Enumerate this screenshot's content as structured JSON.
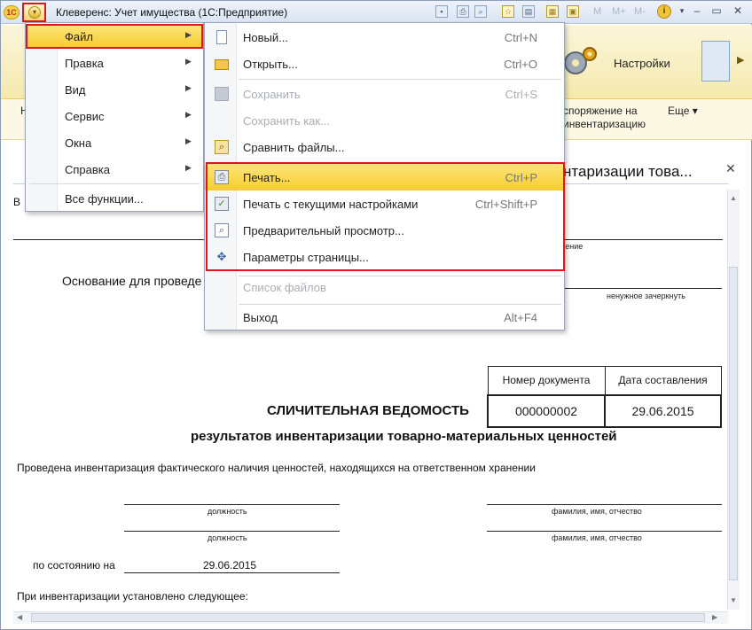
{
  "window": {
    "title": "Клеверенс: Учет имущества  (1С:Предприятие)",
    "logo": "1С",
    "toolbar_texts": [
      "M",
      "M+",
      "M-"
    ]
  },
  "ribbon": {
    "settings_label": "Настройки"
  },
  "nav": {
    "first_fragment": "Н",
    "link_1": "споряжение на инвентаризацию",
    "more": "Еще ▾"
  },
  "main_menu": {
    "items": [
      {
        "label": "Файл",
        "has_submenu": true,
        "active": true
      },
      {
        "label": "Правка",
        "has_submenu": true
      },
      {
        "label": "Вид",
        "has_submenu": true
      },
      {
        "label": "Сервис",
        "has_submenu": true
      },
      {
        "label": "Окна",
        "has_submenu": true
      },
      {
        "label": "Справка",
        "has_submenu": true
      },
      {
        "label": "Все функции...",
        "has_submenu": false
      }
    ]
  },
  "file_menu": {
    "items": [
      {
        "label": "Новый...",
        "shortcut": "Ctrl+N",
        "icon": "new-document-icon",
        "disabled": false
      },
      {
        "label": "Открыть...",
        "shortcut": "Ctrl+O",
        "icon": "open-folder-icon",
        "disabled": false
      },
      {
        "label": "Сохранить",
        "shortcut": "Ctrl+S",
        "icon": "save-icon",
        "disabled": true
      },
      {
        "label": "Сохранить как...",
        "shortcut": "",
        "icon": "",
        "disabled": true
      },
      {
        "label": "Сравнить файлы...",
        "shortcut": "",
        "icon": "compare-files-icon",
        "disabled": false
      },
      {
        "label": "Печать...",
        "shortcut": "Ctrl+P",
        "icon": "printer-icon",
        "disabled": false,
        "highlighted": true
      },
      {
        "label": "Печать с текущими настройками",
        "shortcut": "Ctrl+Shift+P",
        "icon": "quick-print-icon",
        "disabled": false
      },
      {
        "label": "Предварительный просмотр...",
        "shortcut": "",
        "icon": "print-preview-icon",
        "disabled": false
      },
      {
        "label": "Параметры страницы...",
        "shortcut": "",
        "icon": "page-setup-icon",
        "disabled": false
      },
      {
        "label": "Список файлов",
        "shortcut": "",
        "icon": "",
        "disabled": true
      },
      {
        "label": "Выход",
        "shortcut": "Alt+F4",
        "icon": "",
        "disabled": false
      }
    ]
  },
  "document": {
    "header_fragment": "нтаризации това...",
    "left_fragment_B": "В",
    "small_fragment_1": "ление",
    "basis_label": "Основание для проведе",
    "strike_hint": "ненужное зачеркнуть",
    "doc_table": {
      "headers": [
        "Номер документа",
        "Дата составления"
      ],
      "values": [
        "000000002",
        "29.06.2015"
      ]
    },
    "title_main": "СЛИЧИТЕЛЬНАЯ ВЕДОМОСТЬ",
    "subtitle": "результатов инвентаризации товарно-материальных ценностей",
    "intro": "Проведена инвентаризация фактического наличия ценностей, находящихся на ответственном хранении",
    "position_label": "должность",
    "fio_label": "фамилия, имя, отчество",
    "as_of_label": "по состоянию на",
    "as_of_date": "29.06.2015",
    "established": "При инвентаризации установлено следующее:"
  },
  "colors": {
    "highlight_red": "#e01616",
    "menu_highlight": "#f6cd2d",
    "ribbon_bg": "#f5e9ac"
  }
}
